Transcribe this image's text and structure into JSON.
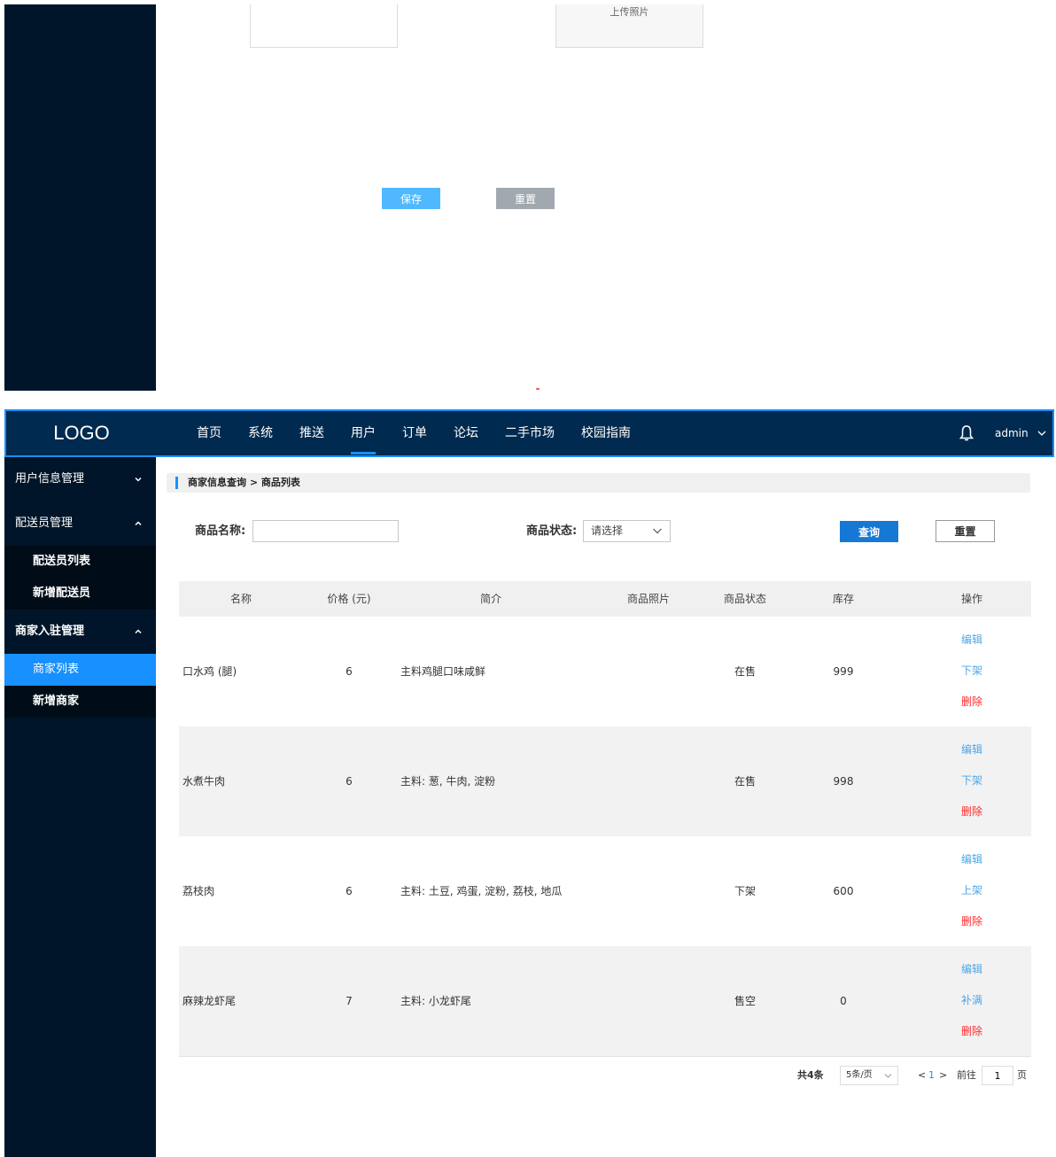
{
  "top_fragment": {
    "upload_label": "上传照片",
    "save_label": "保存",
    "reset_label": "重置"
  },
  "header": {
    "logo": "LOGO",
    "nav": [
      "首页",
      "系统",
      "推送",
      "用户",
      "订单",
      "论坛",
      "二手市场",
      "校园指南"
    ],
    "active_nav": "用户",
    "username": "admin"
  },
  "sidebar": {
    "groups": [
      {
        "label": "用户信息管理",
        "expanded": false,
        "items": []
      },
      {
        "label": "配送员管理",
        "expanded": true,
        "items": [
          "配送员列表",
          "新增配送员"
        ]
      },
      {
        "label": "商家入驻管理",
        "expanded": true,
        "items": [
          "商家列表",
          "新增商家"
        ]
      }
    ],
    "active_item": "商家列表"
  },
  "breadcrumb": "商家信息查询 > 商品列表",
  "filters": {
    "name_label": "商品名称:",
    "name_value": "",
    "status_label": "商品状态:",
    "status_placeholder": "请选择",
    "query_label": "查询",
    "reset_label": "重置"
  },
  "table": {
    "columns": [
      "名称",
      "价格 (元)",
      "简介",
      "商品照片",
      "商品状态",
      "库存",
      "操作"
    ],
    "rows": [
      {
        "name": "口水鸡 (腿)",
        "price": "6",
        "desc": "主料鸡腿口味咸鲜",
        "status": "在售",
        "stock": "999",
        "ops": [
          "编辑",
          "下架",
          "删除"
        ]
      },
      {
        "name": "水煮牛肉",
        "price": "6",
        "desc": "主料: 葱, 牛肉, 淀粉",
        "status": "在售",
        "stock": "998",
        "ops": [
          "编辑",
          "下架",
          "删除"
        ]
      },
      {
        "name": "荔枝肉",
        "price": "6",
        "desc": "主料: 土豆, 鸡蛋, 淀粉, 荔枝, 地瓜",
        "status": "下架",
        "stock": "600",
        "ops": [
          "编辑",
          "上架",
          "删除"
        ]
      },
      {
        "name": "麻辣龙虾尾",
        "price": "7",
        "desc": "主料: 小龙虾尾",
        "status": "售空",
        "stock": "0",
        "ops": [
          "编辑",
          "补满",
          "删除"
        ]
      }
    ]
  },
  "pagination": {
    "total": "共4条",
    "page_size": "5条/页",
    "prev": "<",
    "current": "1",
    "next": ">",
    "goto_label": "前往",
    "goto_value": "1",
    "unit": "页"
  },
  "colors": {
    "sidebar_bg": "#001529",
    "header_bg": "#002a4f",
    "accent": "#1890ff",
    "danger": "#ff2a2a",
    "link": "#4fa7e8"
  }
}
